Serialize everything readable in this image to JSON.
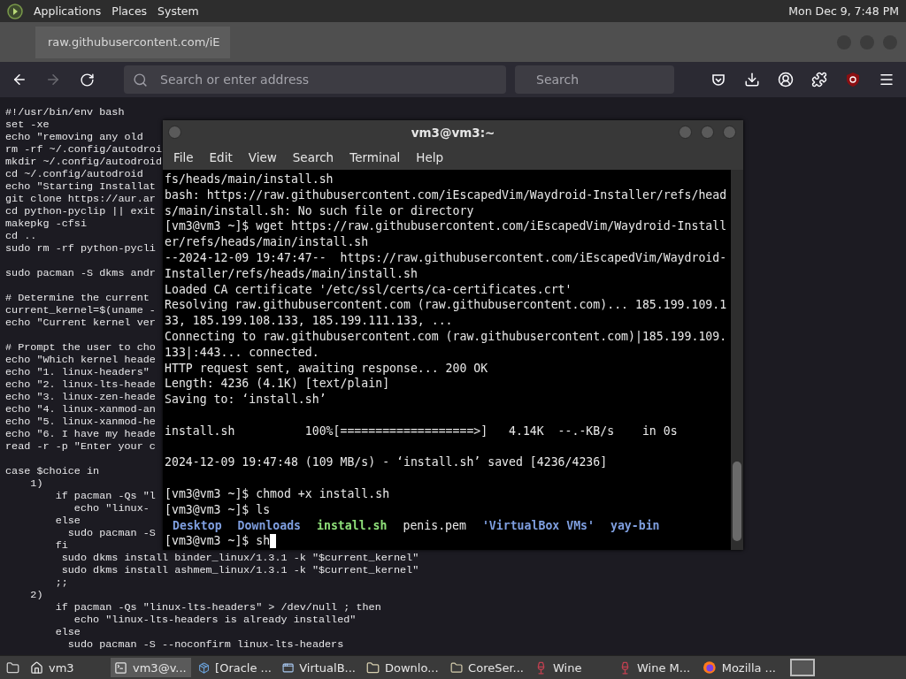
{
  "top_panel": {
    "menus": [
      "Applications",
      "Places",
      "System"
    ],
    "clock": "Mon Dec 9, 7:48 PM"
  },
  "browser": {
    "tabs": [
      {
        "label": "raw.githubusercontent.com/iE",
        "selected": true
      }
    ],
    "address": {
      "placeholder": "Search or enter address"
    },
    "search": {
      "placeholder": "Search"
    },
    "page_lines": [
      {
        "kind": "text",
        "text": "#!/usr/bin/env bash"
      },
      {
        "kind": "text",
        "text": "set -xe"
      },
      {
        "kind": "text",
        "text": "echo \"removing any old"
      },
      {
        "kind": "text",
        "text": "rm -rf ~/.config/autodroi"
      },
      {
        "kind": "text",
        "text": "mkdir ~/.config/autodroid"
      },
      {
        "kind": "text",
        "text": "cd ~/.config/autodroid"
      },
      {
        "kind": "text",
        "text": "echo \"Starting Installat"
      },
      {
        "kind": "text",
        "text": "git clone https://aur.ar"
      },
      {
        "kind": "text",
        "text": "cd python-pyclip || exit"
      },
      {
        "kind": "text",
        "text": "makepkg -cfsi"
      },
      {
        "kind": "text",
        "text": "cd .."
      },
      {
        "kind": "text",
        "text": "sudo rm -rf python-pycli"
      },
      {
        "kind": "blank"
      },
      {
        "kind": "text",
        "text": "sudo pacman -S dkms andr"
      },
      {
        "kind": "blank"
      },
      {
        "kind": "text",
        "text": "# Determine the current"
      },
      {
        "kind": "text",
        "text": "current_kernel=$(uname -"
      },
      {
        "kind": "text",
        "text": "echo \"Current kernel ver"
      },
      {
        "kind": "blank"
      },
      {
        "kind": "text",
        "text": "# Prompt the user to cho"
      },
      {
        "kind": "text",
        "text": "echo \"Which kernel heade"
      },
      {
        "kind": "text",
        "text": "echo \"1. linux-headers\""
      },
      {
        "kind": "text",
        "text": "echo \"2. linux-lts-heade"
      },
      {
        "kind": "text",
        "text": "echo \"3. linux-zen-heade"
      },
      {
        "kind": "text",
        "text": "echo \"4. linux-xanmod-an"
      },
      {
        "kind": "text",
        "text": "echo \"5. linux-xanmod-he"
      },
      {
        "kind": "text",
        "text": "echo \"6. I have my heade"
      },
      {
        "kind": "text",
        "text": "read -r -p \"Enter your c"
      },
      {
        "kind": "blank"
      },
      {
        "kind": "text",
        "text": "case $choice in"
      },
      {
        "kind": "text",
        "text": "    1)"
      },
      {
        "kind": "text",
        "text": "        if pacman -Qs \"l"
      },
      {
        "kind": "text",
        "text": "           echo \"linux-"
      },
      {
        "kind": "text",
        "text": "        else"
      },
      {
        "kind": "text",
        "text": "          sudo pacman -S"
      },
      {
        "kind": "text",
        "text": "        fi"
      },
      {
        "kind": "text",
        "text": "         sudo dkms install binder_linux/1.3.1 -k \"$current_kernel\""
      },
      {
        "kind": "text",
        "text": "         sudo dkms install ashmem_linux/1.3.1 -k \"$current_kernel\""
      },
      {
        "kind": "text",
        "text": "        ;;"
      },
      {
        "kind": "text",
        "text": "    2)"
      },
      {
        "kind": "text",
        "text": "        if pacman -Qs \"linux-lts-headers\" > /dev/null ; then"
      },
      {
        "kind": "text",
        "text": "           echo \"linux-lts-headers is already installed\""
      },
      {
        "kind": "text",
        "text": "        else"
      },
      {
        "kind": "text",
        "text": "          sudo pacman -S --noconfirm linux-lts-headers"
      }
    ]
  },
  "terminal": {
    "title": "vm3@vm3:~",
    "menus": [
      "File",
      "Edit",
      "View",
      "Search",
      "Terminal",
      "Help"
    ],
    "lines": [
      {
        "kind": "text",
        "text": "fs/heads/main/install.sh"
      },
      {
        "kind": "text",
        "text": "bash: https://raw.githubusercontent.com/iEscapedVim/Waydroid-Installer/refs/head"
      },
      {
        "kind": "text",
        "text": "s/main/install.sh: No such file or directory"
      },
      {
        "kind": "text",
        "text": "[vm3@vm3 ~]$ wget https://raw.githubusercontent.com/iEscapedVim/Waydroid-Install"
      },
      {
        "kind": "text",
        "text": "er/refs/heads/main/install.sh"
      },
      {
        "kind": "text",
        "text": "--2024-12-09 19:47:47--  https://raw.githubusercontent.com/iEscapedVim/Waydroid-"
      },
      {
        "kind": "text",
        "text": "Installer/refs/heads/main/install.sh"
      },
      {
        "kind": "text",
        "text": "Loaded CA certificate '/etc/ssl/certs/ca-certificates.crt'"
      },
      {
        "kind": "text",
        "text": "Resolving raw.githubusercontent.com (raw.githubusercontent.com)... 185.199.109.1"
      },
      {
        "kind": "text",
        "text": "33, 185.199.108.133, 185.199.111.133, ..."
      },
      {
        "kind": "text",
        "text": "Connecting to raw.githubusercontent.com (raw.githubusercontent.com)|185.199.109."
      },
      {
        "kind": "text",
        "text": "133|:443... connected."
      },
      {
        "kind": "text",
        "text": "HTTP request sent, awaiting response... 200 OK"
      },
      {
        "kind": "text",
        "text": "Length: 4236 (4.1K) [text/plain]"
      },
      {
        "kind": "text",
        "text": "Saving to: ‘install.sh’"
      },
      {
        "kind": "blank"
      },
      {
        "kind": "text",
        "text": "install.sh          100%[===================>]   4.14K  --.-KB/s    in 0s"
      },
      {
        "kind": "blank"
      },
      {
        "kind": "text",
        "text": "2024-12-09 19:47:48 (109 MB/s) - ‘install.sh’ saved [4236/4236]"
      },
      {
        "kind": "blank"
      },
      {
        "kind": "text",
        "text": "[vm3@vm3 ~]$ chmod +x install.sh"
      },
      {
        "kind": "text",
        "text": "[vm3@vm3 ~]$ ls"
      },
      {
        "kind": "listing",
        "items": [
          {
            "name": "Desktop",
            "kind": "dir"
          },
          {
            "name": "Downloads",
            "kind": "dir"
          },
          {
            "name": "install.sh",
            "kind": "exec"
          },
          {
            "name": "penis.pem",
            "kind": "file"
          },
          {
            "name": "'VirtualBox VMs'",
            "kind": "dir"
          },
          {
            "name": "yay-bin",
            "kind": "dir"
          }
        ]
      },
      {
        "kind": "prompt",
        "text": "[vm3@vm3 ~]$ sh"
      }
    ]
  },
  "taskbar": {
    "items": [
      {
        "label": "vm3",
        "kind": "home",
        "selected": false
      },
      {
        "label": "vm3@v...",
        "kind": "terminal",
        "selected": true
      },
      {
        "label": "[Oracle ...",
        "kind": "app",
        "selected": false
      },
      {
        "label": "VirtualB...",
        "kind": "window",
        "selected": false
      },
      {
        "label": "Downlo...",
        "kind": "folder",
        "selected": false
      },
      {
        "label": "CoreSer...",
        "kind": "folder",
        "selected": false
      },
      {
        "label": "Wine",
        "kind": "wine",
        "selected": false
      },
      {
        "label": "Wine M...",
        "kind": "wine",
        "selected": false
      },
      {
        "label": "Mozilla ...",
        "kind": "browser",
        "selected": false
      }
    ]
  }
}
